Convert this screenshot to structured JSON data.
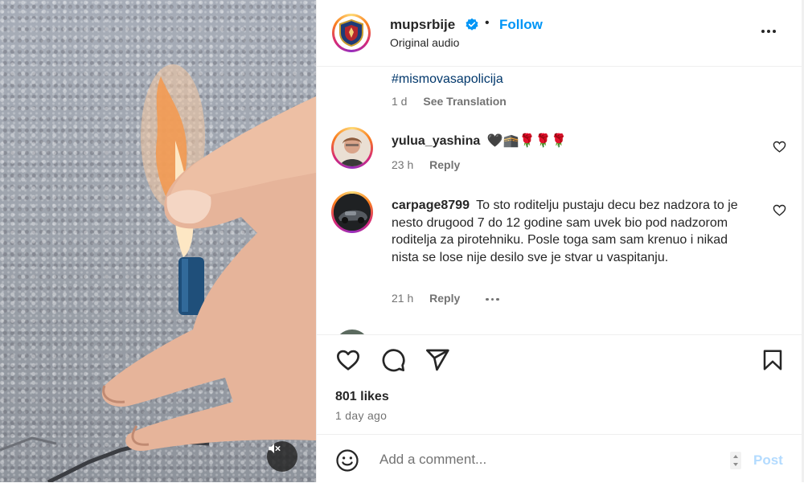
{
  "post": {
    "username": "mupsrbije",
    "follow_label": "Follow",
    "audio": "Original audio",
    "separator": "•",
    "caption_hashtag": "#mismovasapolicija",
    "caption_age": "1 d",
    "see_translation": "See Translation"
  },
  "comments": [
    {
      "username": "yulua_yashina",
      "text": "🖤🕋🌹🌹🌹",
      "age": "23 h",
      "reply_label": "Reply"
    },
    {
      "username": "carpage8799",
      "text": "To sto roditelju pustaju decu bez nadzora to je nesto drugood 7 do 12 godine sam uvek bio pod nadzorom roditelja za pirotehniku. Posle toga sam sam krenuo i nikad nista se lose nije desilo sve je stvar u vaspitanju.",
      "age": "21 h",
      "reply_label": "Reply"
    }
  ],
  "engagement": {
    "likes": "801 likes",
    "date": "1 day ago"
  },
  "composer": {
    "placeholder": "Add a comment...",
    "post_label": "Post"
  },
  "colors": {
    "accent": "#0095f6",
    "hashtag": "#00376b",
    "secondary_text": "#737373",
    "post_disabled": "#b3dbff"
  },
  "icons": {
    "verified": "verified-badge-icon",
    "like": "heart-icon",
    "comment": "comment-icon",
    "share": "share-icon",
    "save": "bookmark-icon",
    "emoji": "emoji-icon",
    "mute": "muted-speaker-icon"
  }
}
